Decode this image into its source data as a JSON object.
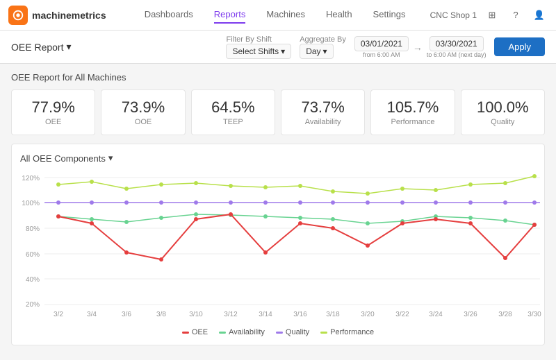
{
  "app": {
    "logo_text": "machinemetrics",
    "shop_name": "CNC Shop 1"
  },
  "nav": {
    "items": [
      {
        "label": "Dashboards",
        "active": false
      },
      {
        "label": "Reports",
        "active": true
      },
      {
        "label": "Machines",
        "active": false
      },
      {
        "label": "Health",
        "active": false
      },
      {
        "label": "Settings",
        "active": false
      }
    ]
  },
  "toolbar": {
    "report_label": "OEE Report",
    "filter_by_shift_label": "Filter By Shift",
    "shift_select": "Select Shifts",
    "aggregate_by_label": "Aggregate By",
    "aggregate_value": "Day",
    "from_date": "03/01/2021",
    "from_sub": "from 6:00 AM",
    "to_date": "03/30/2021",
    "to_sub": "to 6:00 AM (next day)",
    "apply_label": "Apply"
  },
  "report": {
    "title": "OEE Report for All Machines"
  },
  "metrics": [
    {
      "value": "77.9%",
      "label": "OEE"
    },
    {
      "value": "73.9%",
      "label": "OOE"
    },
    {
      "value": "64.5%",
      "label": "TEEP"
    },
    {
      "value": "73.7%",
      "label": "Availability"
    },
    {
      "value": "105.7%",
      "label": "Performance"
    },
    {
      "value": "100.0%",
      "label": "Quality"
    }
  ],
  "chart": {
    "title": "All OEE Components",
    "y_labels": [
      "120%",
      "100%",
      "80%",
      "60%",
      "40%",
      "20%"
    ],
    "x_labels": [
      "3/2",
      "3/4",
      "3/6",
      "3/8",
      "3/10",
      "3/12",
      "3/14",
      "3/16",
      "3/18",
      "3/20",
      "3/22",
      "3/24",
      "3/26",
      "3/28",
      "3/30"
    ],
    "legend": [
      {
        "label": "OEE",
        "color": "#e53e3e"
      },
      {
        "label": "Availability",
        "color": "#68d391"
      },
      {
        "label": "Quality",
        "color": "#9f7aea"
      },
      {
        "label": "Performance",
        "color": "#b8e04a"
      }
    ]
  }
}
